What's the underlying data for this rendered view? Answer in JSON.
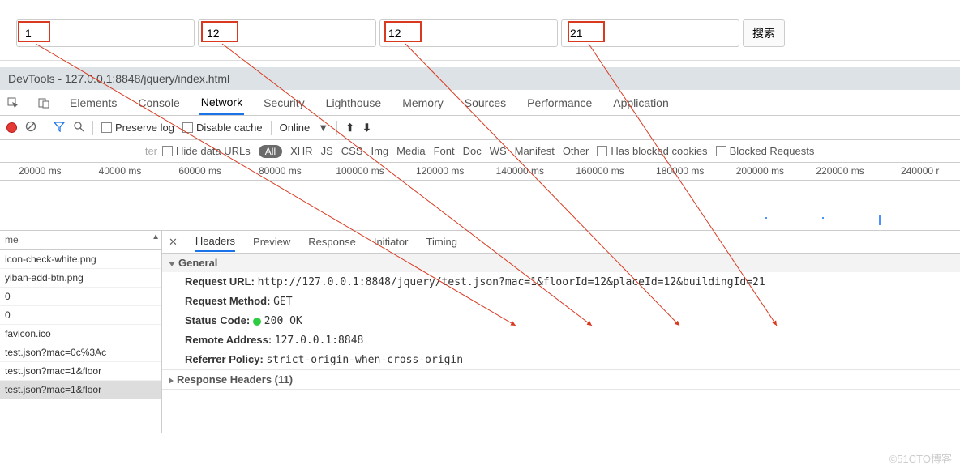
{
  "form": {
    "inputs": [
      "1",
      "12",
      "12",
      "21"
    ],
    "search_label": "搜索"
  },
  "devtools_title": "DevTools - 127.0.0.1:8848/jquery/index.html",
  "main_tabs": [
    "Elements",
    "Console",
    "Network",
    "Security",
    "Lighthouse",
    "Memory",
    "Sources",
    "Performance",
    "Application"
  ],
  "toolbar": {
    "preserve_log": "Preserve log",
    "disable_cache": "Disable cache",
    "throttle": "Online"
  },
  "filter": {
    "placeholder": "ter",
    "hide_data_urls": "Hide data URLs",
    "all_pill": "All",
    "types": [
      "XHR",
      "JS",
      "CSS",
      "Img",
      "Media",
      "Font",
      "Doc",
      "WS",
      "Manifest",
      "Other"
    ],
    "blocked_cookies": "Has blocked cookies",
    "blocked_requests": "Blocked Requests"
  },
  "timeline_ticks": [
    "20000 ms",
    "40000 ms",
    "60000 ms",
    "80000 ms",
    "100000 ms",
    "120000 ms",
    "140000 ms",
    "160000 ms",
    "180000 ms",
    "200000 ms",
    "220000 ms",
    "240000 r"
  ],
  "request_list": {
    "col_header": "me",
    "rows": [
      "icon-check-white.png",
      "yiban-add-btn.png",
      "0",
      "0",
      "favicon.ico",
      "test.json?mac=0c%3Ac",
      "test.json?mac=1&floor",
      "test.json?mac=1&floor"
    ],
    "selected_index": 7
  },
  "detail_tabs": [
    "Headers",
    "Preview",
    "Response",
    "Initiator",
    "Timing"
  ],
  "general_heading": "General",
  "general": {
    "request_url_k": "Request URL:",
    "request_url_v": "http://127.0.0.1:8848/jquery/test.json?mac=1&floorId=12&placeId=12&buildingId=21",
    "request_method_k": "Request Method:",
    "request_method_v": "GET",
    "status_code_k": "Status Code:",
    "status_code_v": "200 OK",
    "remote_addr_k": "Remote Address:",
    "remote_addr_v": "127.0.0.1:8848",
    "referrer_k": "Referrer Policy:",
    "referrer_v": "strict-origin-when-cross-origin"
  },
  "response_headers_heading": "Response Headers (11)",
  "watermark": "©51CTO博客"
}
